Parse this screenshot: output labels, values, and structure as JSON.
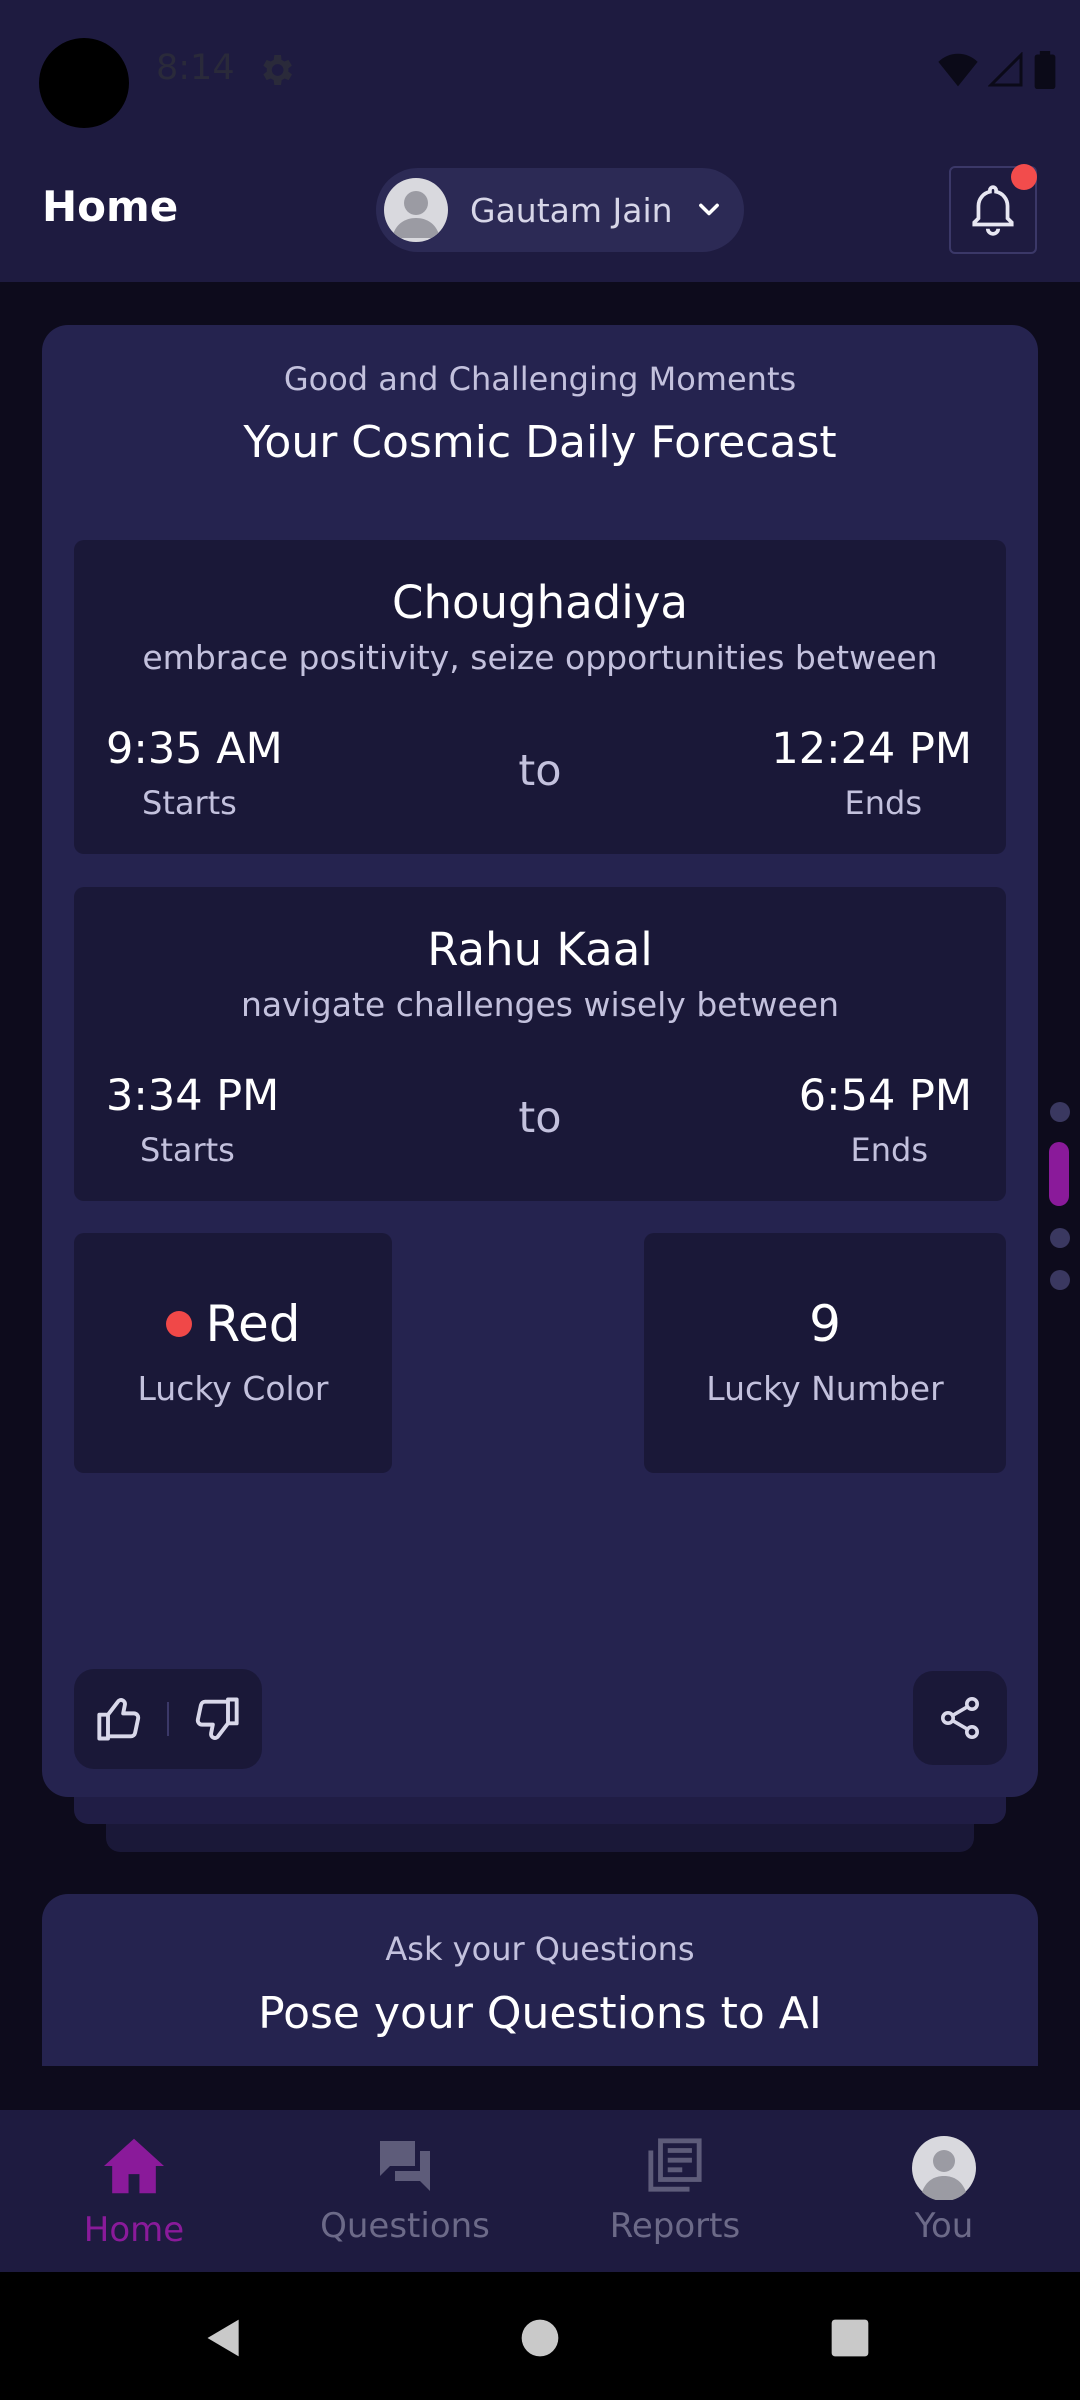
{
  "status_bar": {
    "time": "8:14"
  },
  "header": {
    "title": "Home",
    "profile_name": "Gautam Jain"
  },
  "forecast": {
    "eyebrow": "Good and Challenging Moments",
    "title": "Your Cosmic Daily Forecast",
    "choughadiya": {
      "title": "Choughadiya",
      "subtitle": "embrace positivity, seize opportunities between",
      "start_time": "9:35 AM",
      "start_label": "Starts",
      "separator": "to",
      "end_time": "12:24 PM",
      "end_label": "Ends"
    },
    "rahu_kaal": {
      "title": "Rahu Kaal",
      "subtitle": "navigate challenges wisely between",
      "start_time": "3:34 PM",
      "start_label": "Starts",
      "separator": "to",
      "end_time": "6:54 PM",
      "end_label": "Ends"
    },
    "lucky_color": {
      "value": "Red",
      "label": "Lucky Color",
      "dot_color": "#f04848"
    },
    "lucky_number": {
      "value": "9",
      "label": "Lucky Number"
    }
  },
  "questions": {
    "eyebrow": "Ask your Questions",
    "title": "Pose your Questions to AI"
  },
  "bottom_nav": {
    "items": [
      {
        "label": "Home",
        "icon": "home-icon",
        "active": true
      },
      {
        "label": "Questions",
        "icon": "chat-icon",
        "active": false
      },
      {
        "label": "Reports",
        "icon": "reports-icon",
        "active": false
      },
      {
        "label": "You",
        "icon": "avatar-icon",
        "active": false
      }
    ]
  },
  "colors": {
    "background": "#0d0b1c",
    "header": "#1e1b40",
    "card": "#25234f",
    "inner_box": "#1a1838",
    "accent": "#8a1a9a",
    "notification": "#f24c4c"
  }
}
